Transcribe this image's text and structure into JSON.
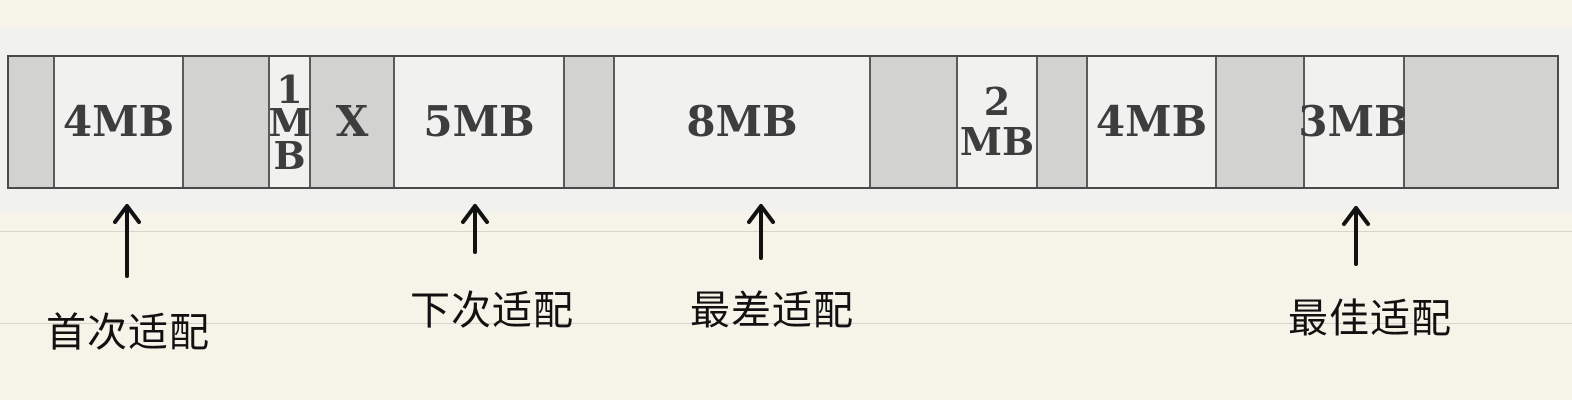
{
  "memory_blocks": [
    {
      "label": "",
      "state": "used"
    },
    {
      "label": "4MB",
      "state": "free"
    },
    {
      "label": "",
      "state": "used"
    },
    {
      "label": "1\nM\nB",
      "state": "free"
    },
    {
      "label": "X",
      "state": "used"
    },
    {
      "label": "5MB",
      "state": "free"
    },
    {
      "label": "",
      "state": "used"
    },
    {
      "label": "8MB",
      "state": "free"
    },
    {
      "label": "",
      "state": "used"
    },
    {
      "label": "2\nMB",
      "state": "free"
    },
    {
      "label": "",
      "state": "used"
    },
    {
      "label": "4MB",
      "state": "free"
    },
    {
      "label": "",
      "state": "used"
    },
    {
      "label": "3MB",
      "state": "free"
    },
    {
      "label": "",
      "state": "used"
    }
  ],
  "annotations": {
    "first_fit": "首次适配",
    "next_fit": "下次适配",
    "worst_fit": "最差适配",
    "best_fit": "最佳适配"
  }
}
